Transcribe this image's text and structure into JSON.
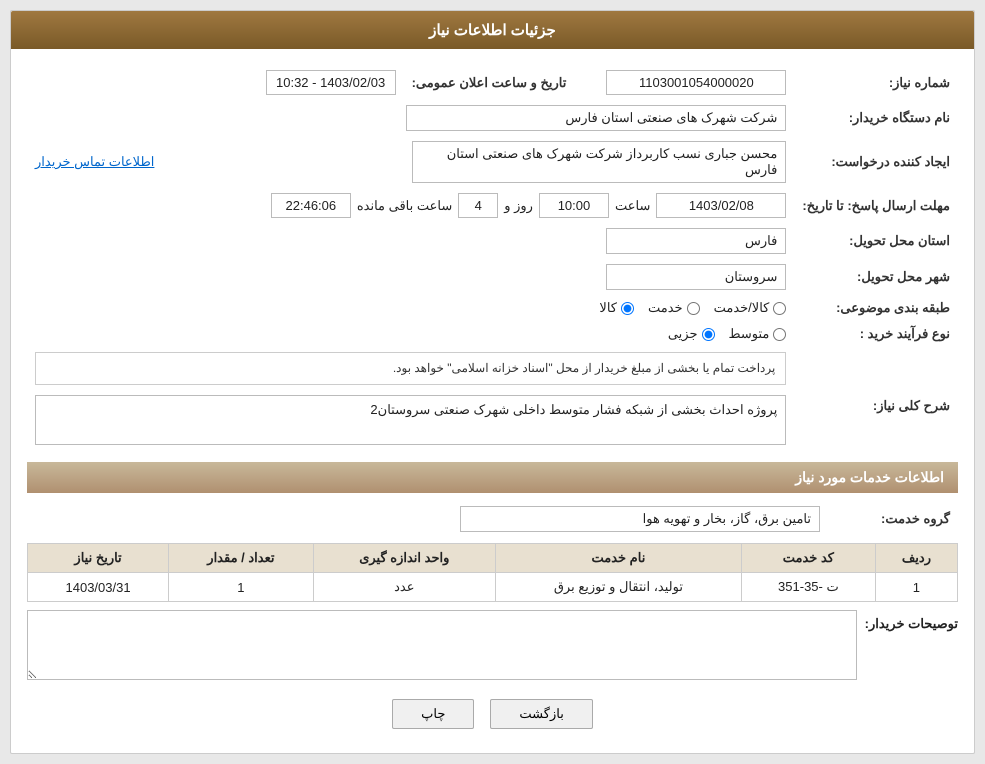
{
  "header": {
    "title": "جزئیات اطلاعات نیاز"
  },
  "fields": {
    "need_number_label": "شماره نیاز:",
    "need_number_value": "1103001054000020",
    "announce_date_label": "تاریخ و ساعت اعلان عمومی:",
    "announce_date_value": "1403/02/03 - 10:32",
    "buyer_name_label": "نام دستگاه خریدار:",
    "buyer_name_value": "شرکت شهرک های صنعتی استان فارس",
    "creator_label": "ایجاد کننده درخواست:",
    "creator_value": "محسن  جباری نسب کاربرداز شرکت شهرک های صنعتی استان فارس",
    "contact_link": "اطلاعات تماس خریدار",
    "deadline_label": "مهلت ارسال پاسخ: تا تاریخ:",
    "deadline_date": "1403/02/08",
    "deadline_time_label": "ساعت",
    "deadline_time": "10:00",
    "deadline_days_label": "روز و",
    "deadline_days": "4",
    "deadline_remaining_label": "ساعت باقی مانده",
    "deadline_remaining": "22:46:06",
    "province_label": "استان محل تحویل:",
    "province_value": "فارس",
    "city_label": "شهر محل تحویل:",
    "city_value": "سروستان",
    "category_label": "طبقه بندی موضوعی:",
    "category_kala": "کالا",
    "category_khedmat": "خدمت",
    "category_kala_khedmat": "کالا/خدمت",
    "purchase_type_label": "نوع فرآیند خرید :",
    "purchase_type_mozayede": "جزیی",
    "purchase_type_motavasset": "متوسط",
    "purchase_notice": "پرداخت تمام یا بخشی از مبلغ خریدار از محل \"اسناد خزانه اسلامی\" خواهد بود.",
    "need_desc_label": "شرح کلی نیاز:",
    "need_desc_value": "پروژه احداث بخشی از شبکه فشار متوسط داخلی شهرک صنعتی سروستان2",
    "services_section": "اطلاعات خدمات مورد نیاز",
    "service_group_label": "گروه خدمت:",
    "service_group_value": "تامین برق، گاز، بخار و تهویه هوا",
    "table_headers": {
      "row": "ردیف",
      "code": "کد خدمت",
      "name": "نام خدمت",
      "unit": "واحد اندازه گیری",
      "count": "تعداد / مقدار",
      "date": "تاریخ نیاز"
    },
    "table_rows": [
      {
        "row": "1",
        "code": "ت -35-351",
        "name": "تولید، انتقال و توزیع برق",
        "unit": "عدد",
        "count": "1",
        "date": "1403/03/31"
      }
    ],
    "buyer_notes_label": "توصیحات خریدار:",
    "buyer_notes_value": ""
  },
  "buttons": {
    "print": "چاپ",
    "back": "بازگشت"
  }
}
